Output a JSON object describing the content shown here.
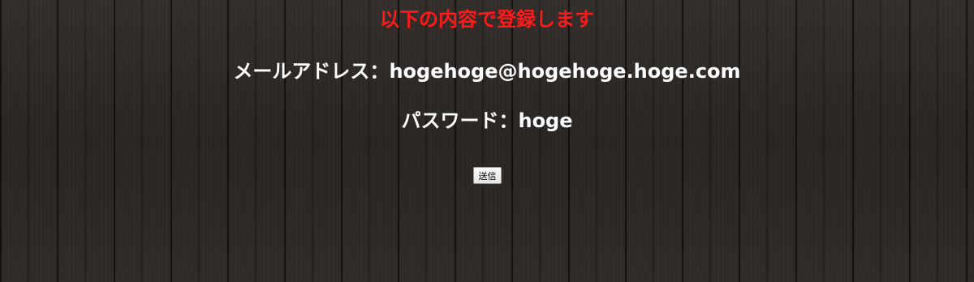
{
  "heading": "以下の内容で登録します",
  "email": {
    "label": "メールアドレス：",
    "value": "hogehoge@hogehoge.hoge.com"
  },
  "password": {
    "label": "パスワード：",
    "value": "hoge"
  },
  "submit_label": "送信",
  "colors": {
    "heading": "#ff1a1a",
    "text": "#ffffff",
    "background": "#2a2624"
  }
}
